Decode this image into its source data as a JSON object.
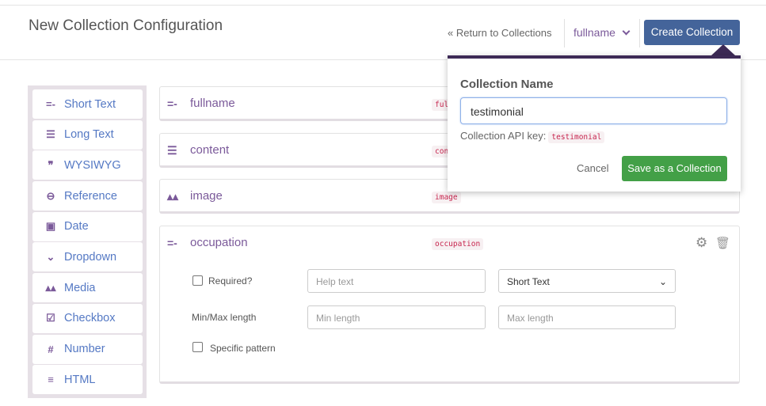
{
  "header": {
    "title": "New Collection Configuration",
    "return_link": "« Return to Collections",
    "field_dropdown": "fullname",
    "create_button": "Create Collection"
  },
  "palette": {
    "items": [
      {
        "label": "Short Text",
        "icon": "short-text-icon",
        "glyph": "=-"
      },
      {
        "label": "Long Text",
        "icon": "long-text-icon",
        "glyph": "☰"
      },
      {
        "label": "WYSIWYG",
        "icon": "quote-icon",
        "glyph": "❞"
      },
      {
        "label": "Reference",
        "icon": "link-icon",
        "glyph": "⊖"
      },
      {
        "label": "Date",
        "icon": "calendar-icon",
        "glyph": "▣"
      },
      {
        "label": "Dropdown",
        "icon": "chevron-down-icon",
        "glyph": "⌄"
      },
      {
        "label": "Media",
        "icon": "image-icon",
        "glyph": "▴▴"
      },
      {
        "label": "Checkbox",
        "icon": "checkbox-icon",
        "glyph": "☑"
      },
      {
        "label": "Number",
        "icon": "hash-icon",
        "glyph": "#"
      },
      {
        "label": "HTML",
        "icon": "list-icon",
        "glyph": "≡"
      }
    ]
  },
  "fields": [
    {
      "name": "fullname",
      "key": "fullname",
      "glyph": "=-"
    },
    {
      "name": "content",
      "key": "content",
      "glyph": "☰"
    },
    {
      "name": "image",
      "key": "image",
      "glyph": "▴▴"
    },
    {
      "name": "occupation",
      "key": "occupation",
      "glyph": "=-"
    }
  ],
  "occupation_settings": {
    "required_label": "Required?",
    "help_placeholder": "Help text",
    "type_value": "Short Text",
    "minmax_label": "Min/Max length",
    "min_placeholder": "Min length",
    "max_placeholder": "Max length",
    "pattern_label": "Specific pattern"
  },
  "popover": {
    "title": "Collection Name",
    "name_value": "testimonial",
    "api_key_label": "Collection API key:",
    "api_key": "testimonial",
    "cancel": "Cancel",
    "save": "Save as a Collection"
  }
}
